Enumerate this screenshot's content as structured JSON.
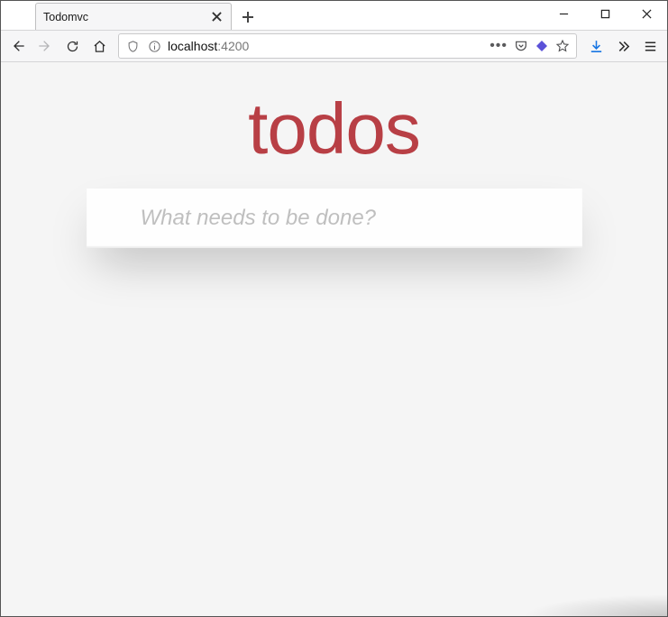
{
  "window": {
    "tab_title": "Todomvc"
  },
  "address": {
    "host": "localhost",
    "port": ":4200"
  },
  "page": {
    "title": "todos",
    "placeholder": "What needs to be done?"
  }
}
